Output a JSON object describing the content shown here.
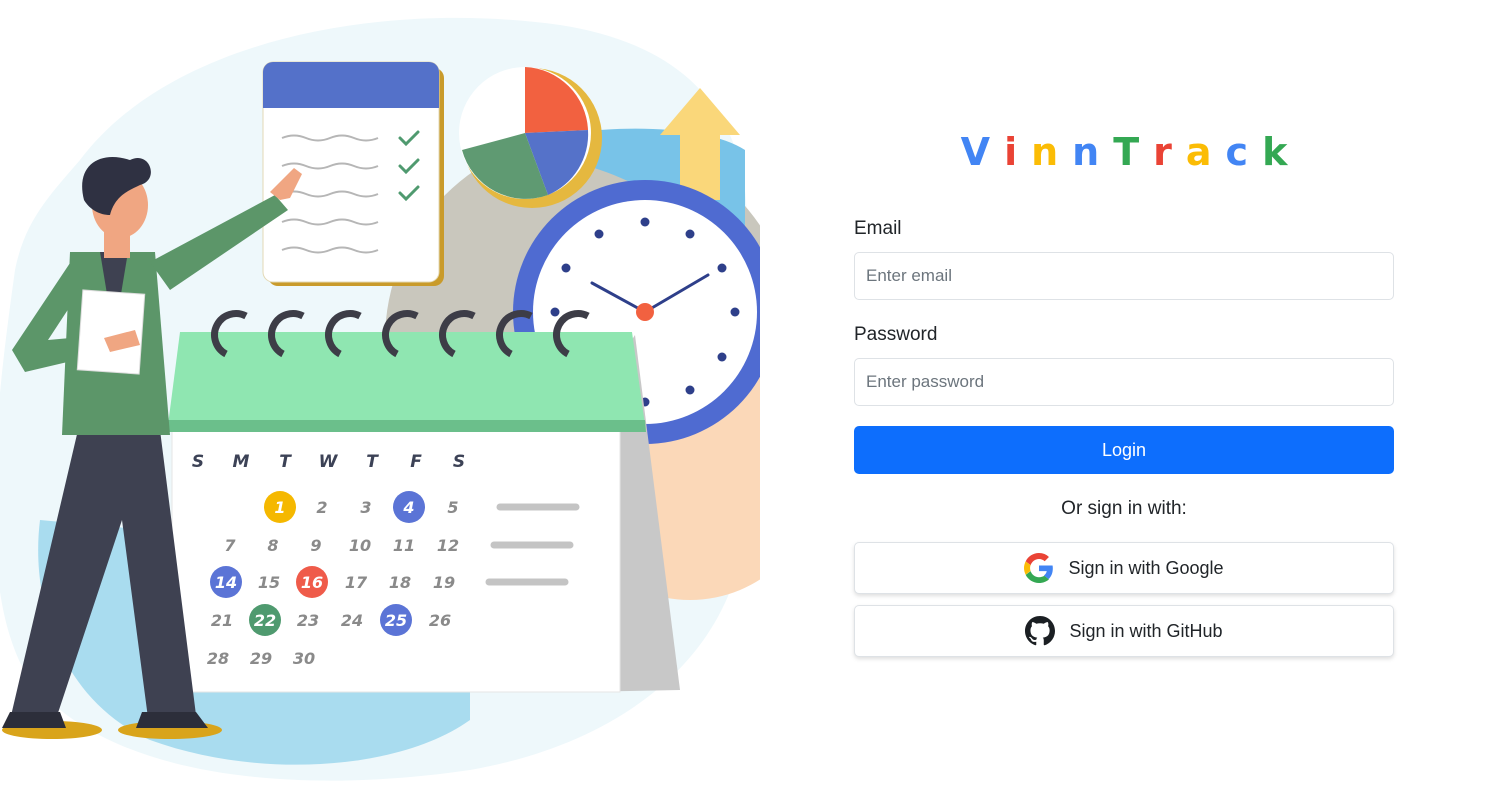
{
  "brand": {
    "letters": [
      {
        "char": "V",
        "color": "#4285F4"
      },
      {
        "char": "i",
        "color": "#EA4335"
      },
      {
        "char": "n",
        "color": "#FBBC05"
      },
      {
        "char": "n",
        "color": "#4285F4"
      },
      {
        "char": "T",
        "color": "#34A853"
      },
      {
        "char": "r",
        "color": "#EA4335"
      },
      {
        "char": "a",
        "color": "#FBBC05"
      },
      {
        "char": "c",
        "color": "#4285F4"
      },
      {
        "char": "k",
        "color": "#34A853"
      }
    ]
  },
  "form": {
    "email_label": "Email",
    "email_placeholder": "Enter email",
    "email_value": "",
    "password_label": "Password",
    "password_placeholder": "Enter password",
    "password_value": "",
    "login_label": "Login",
    "login_color": "#0d6efd",
    "alt_signin_text": "Or sign in with:",
    "google_label": "Sign in with Google",
    "github_label": "Sign in with GitHub",
    "google_icon": "google-g-icon",
    "github_icon": "github-octocat-icon"
  },
  "illustration": {
    "weekdays": [
      "S",
      "M",
      "T",
      "W",
      "T",
      "F",
      "S"
    ],
    "day_rows": [
      [
        "",
        "",
        "1",
        "2",
        "3",
        "4",
        "5"
      ],
      [
        "7",
        "8",
        "9",
        "10",
        "11",
        "12"
      ],
      [
        "14",
        "15",
        "16",
        "17",
        "18",
        "19"
      ],
      [
        "21",
        "22",
        "23",
        "24",
        "25",
        "26"
      ],
      [
        "28",
        "29",
        "30"
      ]
    ],
    "highlighted_days": {
      "1": "#F5B800",
      "4": "#5b74d6",
      "14": "#5b74d6",
      "16": "#ef5b4a",
      "22": "#4f9a6f",
      "25": "#5b74d6"
    }
  }
}
